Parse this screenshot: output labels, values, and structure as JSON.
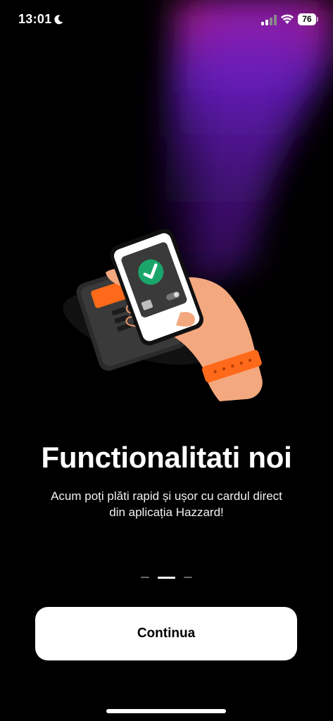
{
  "status_bar": {
    "time": "13:01",
    "battery_level": "76",
    "icons": [
      "moon-icon",
      "signal-icon",
      "wifi-icon",
      "battery-icon"
    ]
  },
  "onboarding": {
    "illustration": "hand-holding-phone-payment-terminal",
    "title": "Functionalitati noi",
    "subtitle": "Acum poți plăti rapid și ușor cu cardul direct din aplicația Hazzard!",
    "pager": {
      "total": 3,
      "active_index": 1
    },
    "continue_label": "Continua"
  },
  "colors": {
    "background": "#000000",
    "beam_purple": "#7a1fd6",
    "beam_magenta": "#c21a8c",
    "accent_orange": "#ff6a1a",
    "check_green": "#1aa66a",
    "skin": "#f3a87f",
    "button_bg": "#ffffff"
  }
}
